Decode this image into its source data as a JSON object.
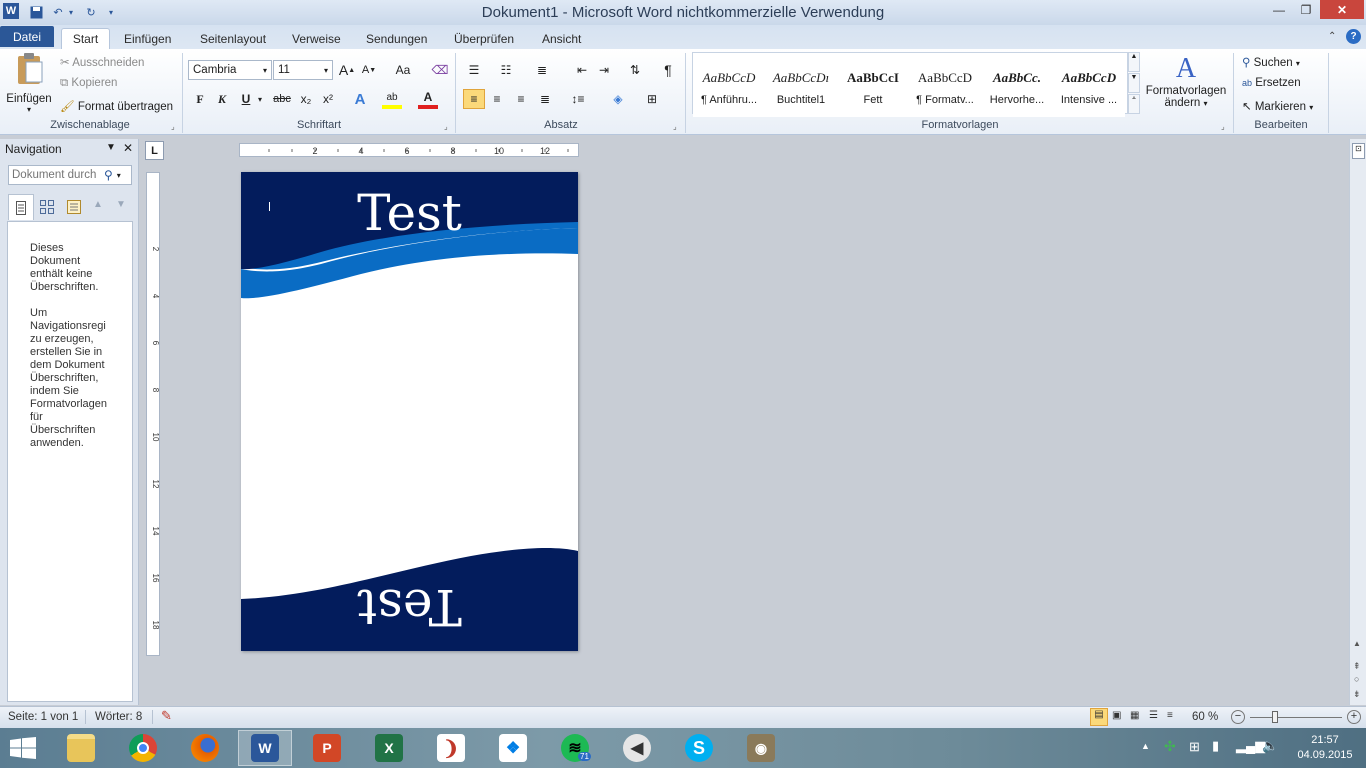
{
  "titlebar": {
    "title": "Dokument1  -  Microsoft Word nichtkommerzielle Verwendung"
  },
  "tabs": [
    "Datei",
    "Start",
    "Einfügen",
    "Seitenlayout",
    "Verweise",
    "Sendungen",
    "Überprüfen",
    "Ansicht"
  ],
  "ribbon": {
    "clipboard": {
      "paste": "Einfügen",
      "cut": "Ausschneiden",
      "copy": "Kopieren",
      "format_painter": "Format übertragen",
      "label": "Zwischenablage"
    },
    "font": {
      "name": "Cambria",
      "size": "11",
      "bold": "F",
      "italic": "K",
      "underline": "U",
      "strike": "abc",
      "sub": "x₂",
      "sup": "x²",
      "label": "Schriftart",
      "grow": "A",
      "shrink": "A",
      "case": "Aa"
    },
    "paragraph": {
      "label": "Absatz"
    },
    "styles": {
      "label": "Formatvorlagen",
      "items": [
        {
          "sample": "AaBbCcD",
          "name": "¶ Anführu..."
        },
        {
          "sample": "AaBbCcDı",
          "name": "Buchtitel1"
        },
        {
          "sample": "AaBbCcI",
          "name": "Fett"
        },
        {
          "sample": "AaBbCcD",
          "name": "¶ Formatv..."
        },
        {
          "sample": "AaBbCc.",
          "name": "Hervorhe..."
        },
        {
          "sample": "AaBbCcD",
          "name": "Intensive ..."
        }
      ],
      "change_line1": "Formatvorlagen",
      "change_line2": "ändern"
    },
    "editing": {
      "find": "Suchen",
      "replace": "Ersetzen",
      "select": "Markieren",
      "label": "Bearbeiten"
    }
  },
  "ruler": {
    "ticks": [
      "2",
      "4",
      "6",
      "8",
      "10",
      "12"
    ]
  },
  "vruler": {
    "ticks": [
      "2",
      "4",
      "6",
      "8",
      "10",
      "12",
      "14",
      "16",
      "18"
    ]
  },
  "navigation": {
    "title": "Navigation",
    "search_placeholder": "Dokument durch",
    "message1": "Dieses\nDokument\nenthält keine\nÜberschriften.",
    "message2": "Um\nNavigationsregi\nzu erzeugen,\nerstellen Sie in\ndem Dokument\nÜberschriften,\nindem Sie\nFormatvorlagen\nfür\nÜberschriften\nanwenden."
  },
  "document": {
    "header_text": "Test",
    "footer_text": "Test",
    "colors": {
      "navy": "#031c5c",
      "blue": "#0a6cc4"
    }
  },
  "status": {
    "page": "Seite: 1 von 1",
    "words": "Wörter: 8",
    "zoom": "60 %"
  },
  "taskbar": {
    "apps": [
      "explorer-icon",
      "chrome-icon",
      "firefox-icon",
      "word-icon",
      "powerpoint-icon",
      "excel-icon",
      "app-icon",
      "dropbox-icon",
      "spotify-icon",
      "speaker-app-icon",
      "skype-icon",
      "gimp-icon"
    ],
    "spotify_badge": "71",
    "time": "21:57",
    "date": "04.09.2015"
  }
}
